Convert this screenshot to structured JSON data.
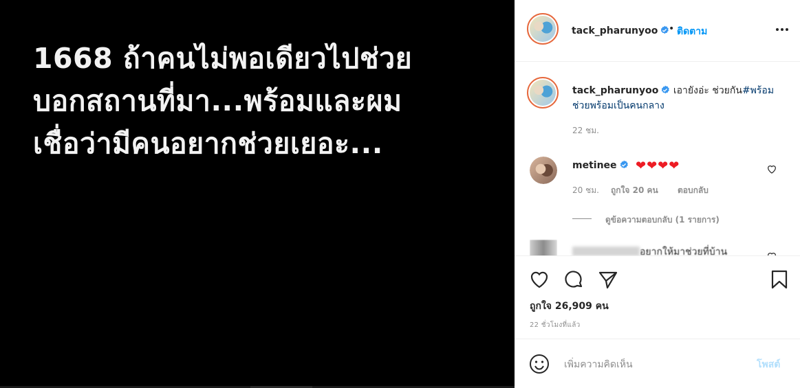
{
  "post": {
    "lines": [
      "1668 ถ้าคนไม่พอเดียวไปช่วย",
      "บอกสถานที่มา...พร้อมและผม",
      "เชื่อว่ามีคนอยากช่วยเยอะ..."
    ]
  },
  "header": {
    "username": "tack_pharunyoo",
    "separator": "•",
    "follow_label": "ติดตาม"
  },
  "caption": {
    "username": "tack_pharunyoo",
    "text": "เอายังอ่ะ ช่วยกัน",
    "hashtag": "#พร้อมช่วยพร้อมเป็นคนกลาง",
    "time": "22 ชม."
  },
  "comments": [
    {
      "username": "metinee",
      "text": "❤❤❤❤",
      "time": "20 ชม.",
      "likes": "ถูกใจ 20 คน",
      "reply_label": "ตอบกลับ",
      "view_replies": "ดูข้อความตอบกลับ (1 รายการ)"
    },
    {
      "username": "",
      "text": "อยากให้มาช่วยที่บ้าน"
    }
  ],
  "stats": {
    "likes": "ถูกใจ 26,909 คน",
    "time": "22 ชั่วโมงที่แล้ว"
  },
  "add_comment": {
    "placeholder": "เพิ่มความคิดเห็น",
    "post_label": "โพสต์"
  },
  "colors": {
    "link": "#0095f6",
    "verified": "#3897f0",
    "heart": "#ed1c24"
  }
}
